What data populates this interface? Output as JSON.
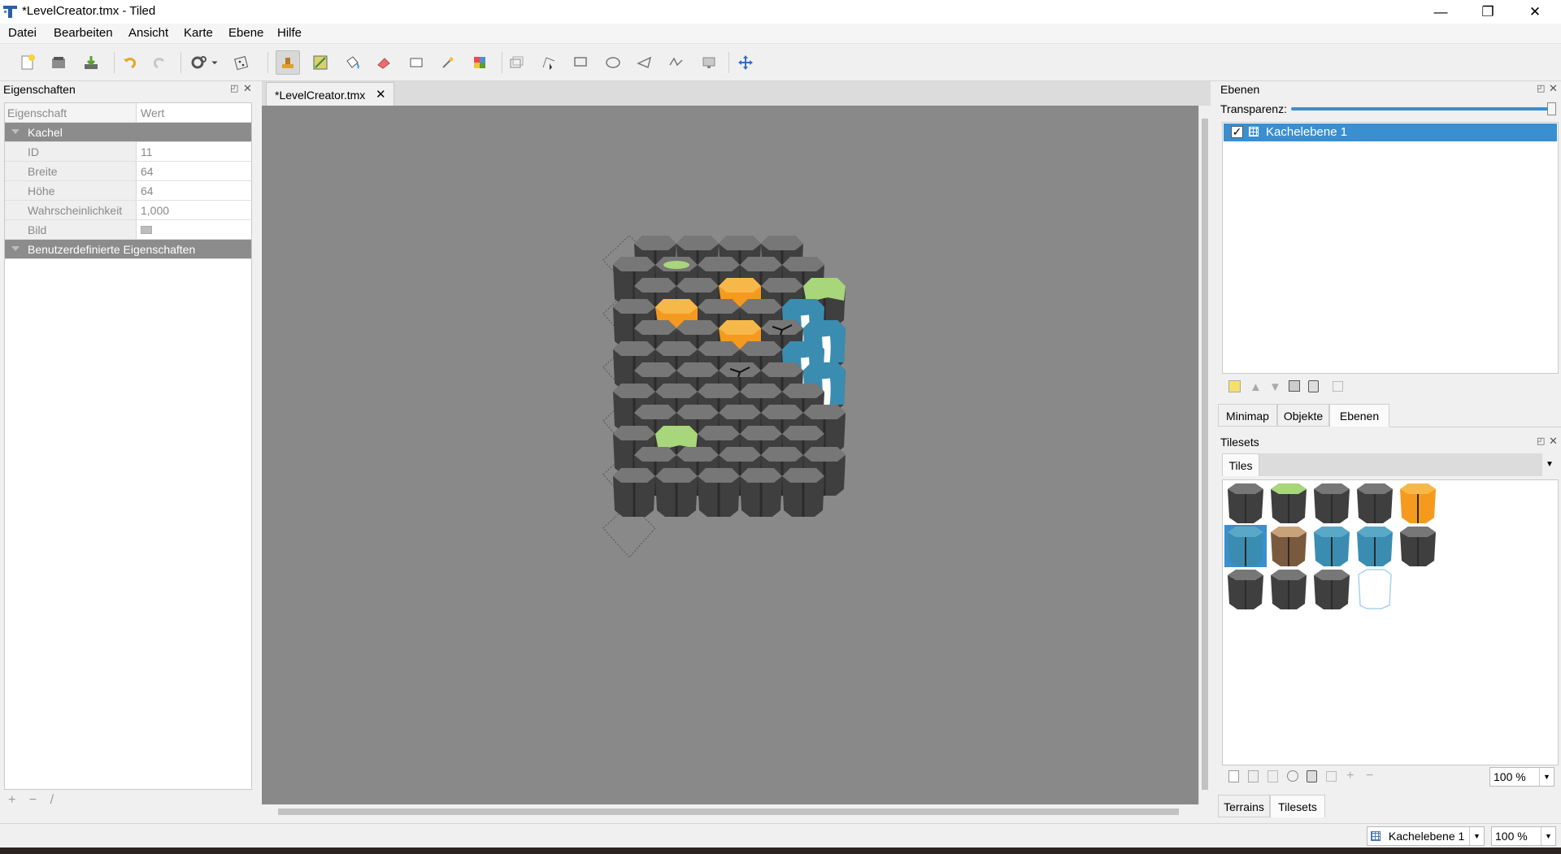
{
  "window": {
    "title": "*LevelCreator.tmx - Tiled",
    "minimize": "—",
    "maximize": "❐",
    "close": "✕"
  },
  "menu": [
    "Datei",
    "Bearbeiten",
    "Ansicht",
    "Karte",
    "Ebene",
    "Hilfe"
  ],
  "properties_panel": {
    "title": "Eigenschaften",
    "columns": [
      "Eigenschaft",
      "Wert"
    ],
    "group_tile": "Kachel",
    "rows": [
      {
        "key": "ID",
        "value": "11"
      },
      {
        "key": "Breite",
        "value": "64"
      },
      {
        "key": "Höhe",
        "value": "64"
      },
      {
        "key": "Wahrscheinlichkeit",
        "value": "1,000"
      },
      {
        "key": "Bild",
        "value": ""
      }
    ],
    "group_custom": "Benutzerdefinierte Eigenschaften",
    "bottom_buttons": [
      "+",
      "−",
      "/"
    ]
  },
  "document": {
    "tab_label": "*LevelCreator.tmx",
    "tab_close": "✕",
    "canvas_color": "#898989"
  },
  "layers_panel": {
    "title": "Ebenen",
    "opacity_label": "Transparenz:",
    "opacity": 1.0,
    "layer_name": "Kachelebene 1",
    "layer_visible": true
  },
  "dock_tabs": {
    "minimap": "Minimap",
    "objects": "Objekte",
    "layers": "Ebenen"
  },
  "tilesets_panel": {
    "title": "Tilesets",
    "tab": "Tiles",
    "zoom": "100 %"
  },
  "bottom_tabs": {
    "terrains": "Terrains",
    "tilesets": "Tilesets"
  },
  "statusbar": {
    "layer": "Kachelebene 1",
    "zoom": "100 %"
  },
  "colors": {
    "selection": "#3a8fd1",
    "rock": "#3f3f3f",
    "lava": "#f59a1e",
    "water": "#3a8db0",
    "slime": "#a8d67a"
  }
}
